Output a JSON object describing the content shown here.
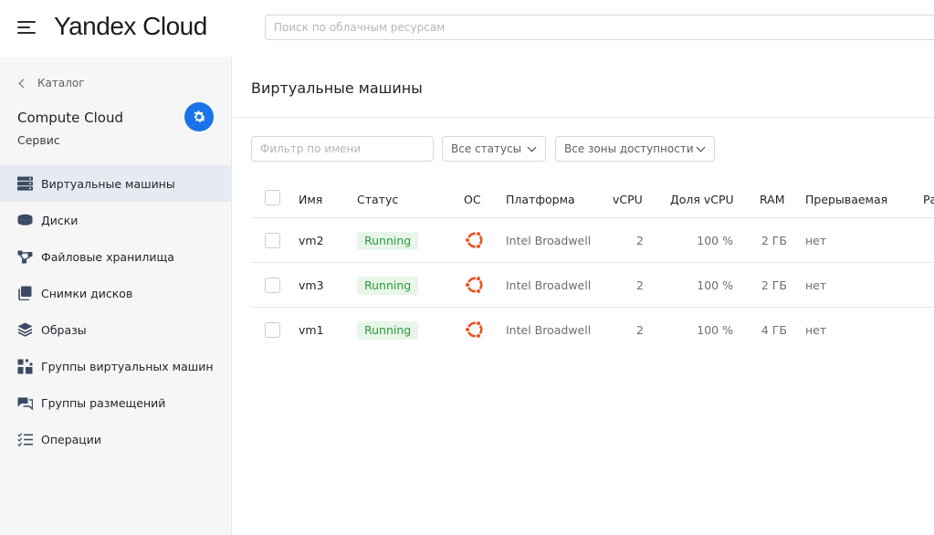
{
  "header": {
    "logo": "Yandex Cloud",
    "search_placeholder": "Поиск по облачным ресурсам"
  },
  "sidebar": {
    "back_label": "Каталог",
    "service_title": "Compute Cloud",
    "service_subtitle": "Сервис",
    "items": [
      {
        "label": "Виртуальные машины",
        "icon": "server-icon",
        "active": true
      },
      {
        "label": "Диски",
        "icon": "disk-icon"
      },
      {
        "label": "Файловые хранилища",
        "icon": "file-storage-icon"
      },
      {
        "label": "Снимки дисков",
        "icon": "snapshot-icon"
      },
      {
        "label": "Образы",
        "icon": "image-layers-icon"
      },
      {
        "label": "Группы виртуальных машин",
        "icon": "instance-group-icon"
      },
      {
        "label": "Группы размещений",
        "icon": "placement-group-icon"
      },
      {
        "label": "Операции",
        "icon": "operations-icon"
      }
    ]
  },
  "main": {
    "title": "Виртуальные машины",
    "filter_placeholder": "Фильтр по имени",
    "status_select": "Все статусы",
    "zone_select": "Все зоны доступности",
    "columns": {
      "name": "Имя",
      "status": "Статус",
      "os": "ОС",
      "platform": "Платформа",
      "vcpu": "vCPU",
      "vcpu_share": "Доля vCPU",
      "ram": "RAM",
      "preemptible": "Прерываемая",
      "extra": "Ра"
    },
    "rows": [
      {
        "name": "vm2",
        "status": "Running",
        "os": "ubuntu-icon",
        "platform": "Intel Broadwell",
        "vcpu": "2",
        "vcpu_share": "100 %",
        "ram": "2 ГБ",
        "preemptible": "нет"
      },
      {
        "name": "vm3",
        "status": "Running",
        "os": "ubuntu-icon",
        "platform": "Intel Broadwell",
        "vcpu": "2",
        "vcpu_share": "100 %",
        "ram": "2 ГБ",
        "preemptible": "нет"
      },
      {
        "name": "vm1",
        "status": "Running",
        "os": "ubuntu-icon",
        "platform": "Intel Broadwell",
        "vcpu": "2",
        "vcpu_share": "100 %",
        "ram": "4 ГБ",
        "preemptible": "нет"
      }
    ]
  },
  "colors": {
    "accent": "#1a73e8",
    "status_running_bg": "#e7f6e9",
    "status_running_text": "#2e9c3b",
    "ubuntu_orange": "#e95420",
    "sidebar_bg": "#f6f6f7",
    "active_item_bg": "#e6ebf2"
  }
}
